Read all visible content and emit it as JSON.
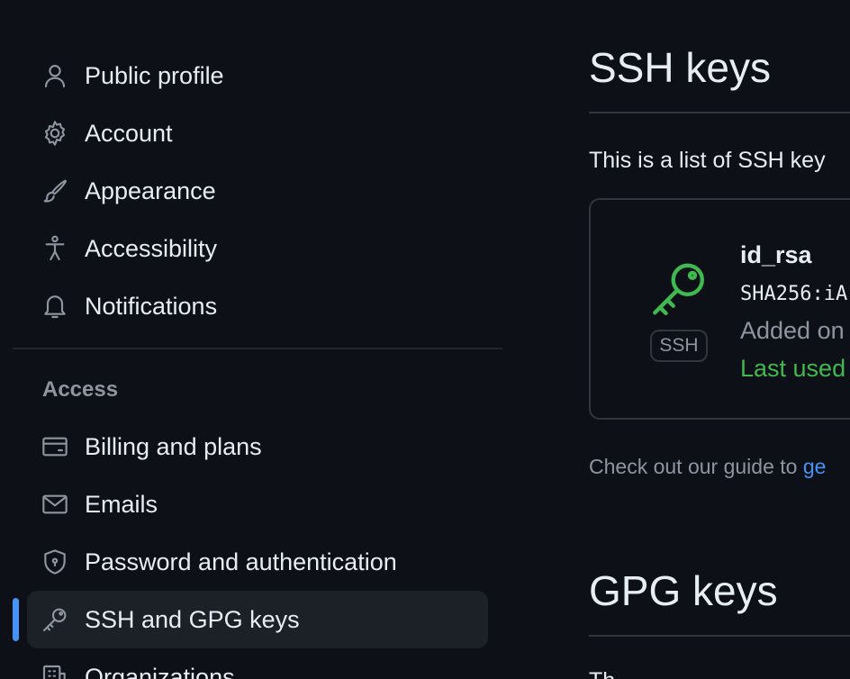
{
  "sidebar": {
    "items": [
      {
        "label": "Public profile",
        "icon": "person-icon"
      },
      {
        "label": "Account",
        "icon": "gear-icon"
      },
      {
        "label": "Appearance",
        "icon": "paintbrush-icon"
      },
      {
        "label": "Accessibility",
        "icon": "accessibility-icon"
      },
      {
        "label": "Notifications",
        "icon": "bell-icon"
      }
    ],
    "access_title": "Access",
    "access_items": [
      {
        "label": "Billing and plans",
        "icon": "credit-card-icon"
      },
      {
        "label": "Emails",
        "icon": "mail-icon"
      },
      {
        "label": "Password and authentication",
        "icon": "shield-lock-icon"
      },
      {
        "label": "SSH and GPG keys",
        "icon": "key-icon",
        "active": true
      },
      {
        "label": "Organizations",
        "icon": "organization-icon"
      }
    ]
  },
  "main": {
    "ssh_title": "SSH keys",
    "ssh_description": "This is a list of SSH key",
    "key": {
      "badge": "SSH",
      "name": "id_rsa",
      "fingerprint": "SHA256:iA",
      "added": "Added on",
      "last_used": "Last used"
    },
    "guide_prefix": "Check out our guide to ",
    "guide_link": "ge",
    "gpg_title": "GPG keys",
    "gpg_description": "Th"
  },
  "colors": {
    "background": "#0d1117",
    "active_indicator": "#4493f8",
    "key_green": "#3fb950",
    "link_blue": "#4493f8"
  }
}
